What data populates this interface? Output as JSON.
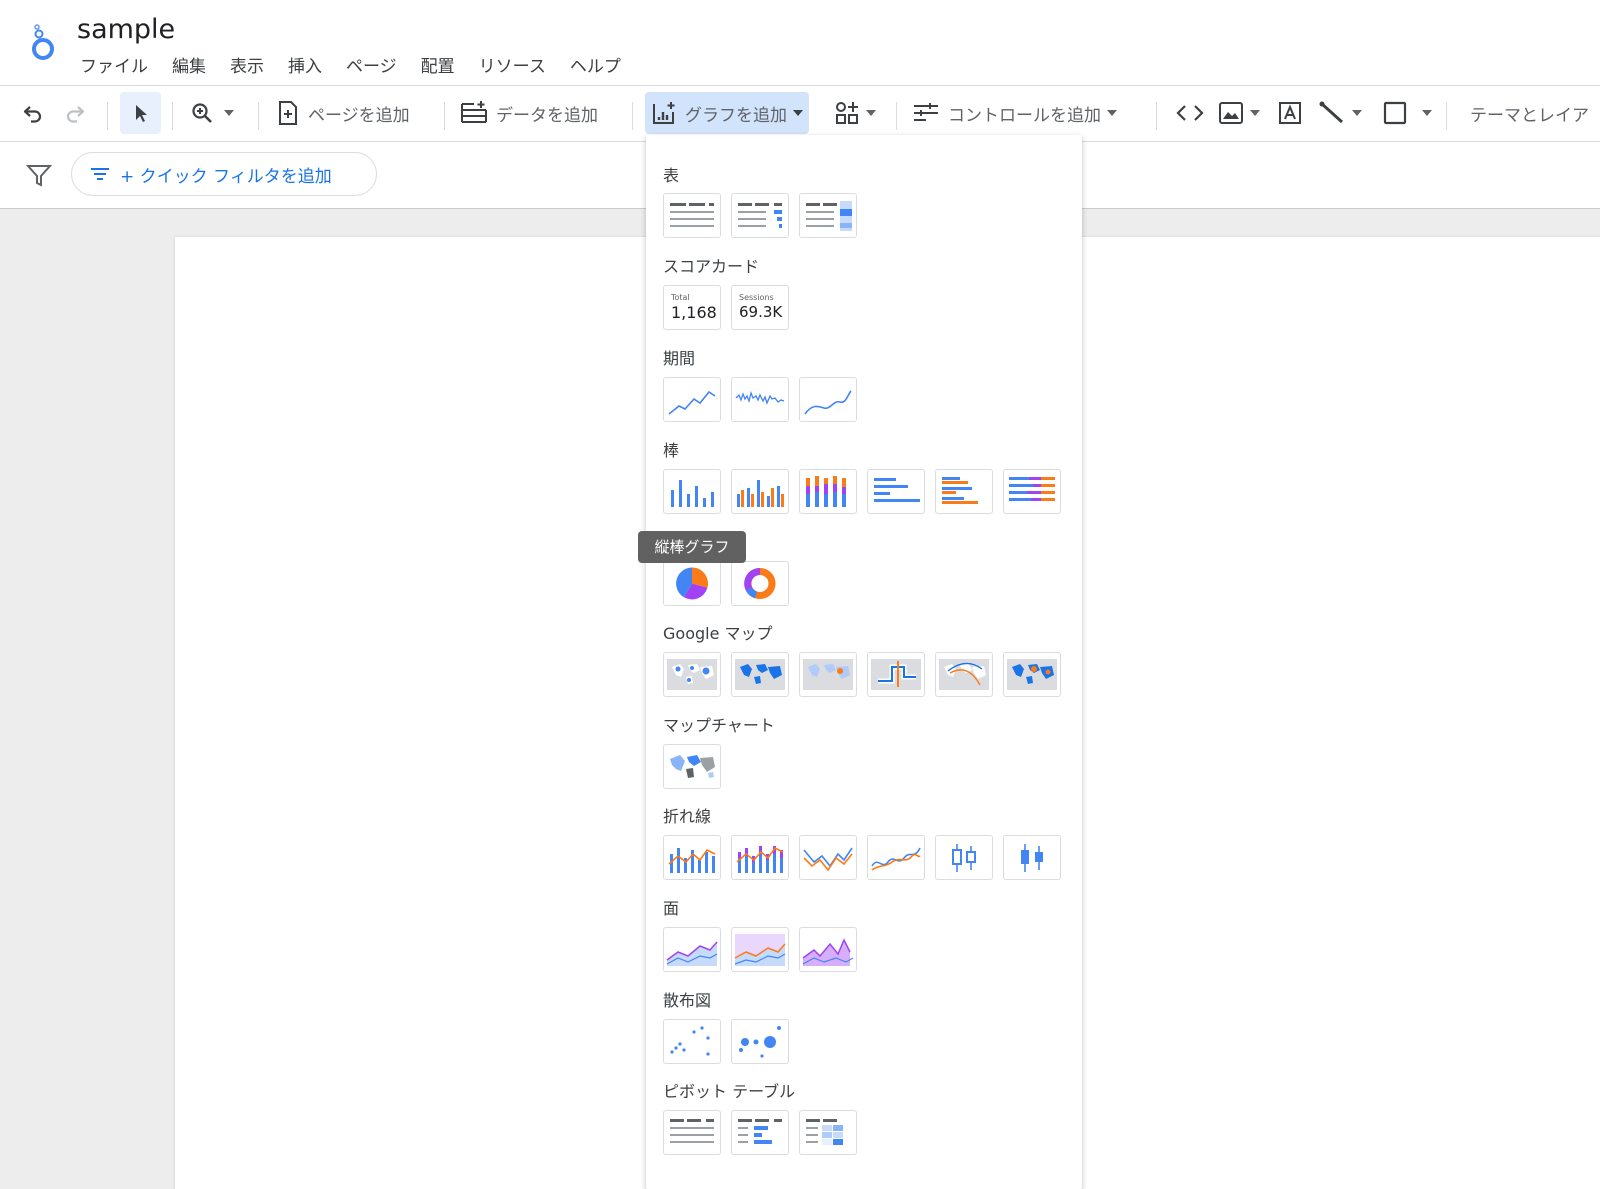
{
  "app": {
    "title": "sample"
  },
  "menu": [
    "ファイル",
    "編集",
    "表示",
    "挿入",
    "ページ",
    "配置",
    "リソース",
    "ヘルプ"
  ],
  "toolbar": {
    "add_page": "ページを追加",
    "add_data": "データを追加",
    "add_chart": "グラフを追加",
    "add_control": "コントロールを追加",
    "theme": "テーマとレイア"
  },
  "filter_bar": {
    "quick_filter": "+ クイック フィルタを追加"
  },
  "chart_menu": {
    "sections": {
      "table": "表",
      "scorecard": "スコアカード",
      "timeseries": "期間",
      "bar": "棒",
      "geo": "Google マップ",
      "map": "マップチャート",
      "line": "折れ線",
      "area": "面",
      "scatter": "散布図",
      "pivot": "ピボット テーブル"
    },
    "scorecards": [
      {
        "label": "Total",
        "value": "1,168"
      },
      {
        "label": "Sessions",
        "value": "69.3K"
      }
    ]
  },
  "tooltip": "縦棒グラフ",
  "colors": {
    "blue": "#4285f4",
    "orange": "#fa7b17",
    "purple": "#a142f4",
    "accent": "#1a73e8"
  }
}
